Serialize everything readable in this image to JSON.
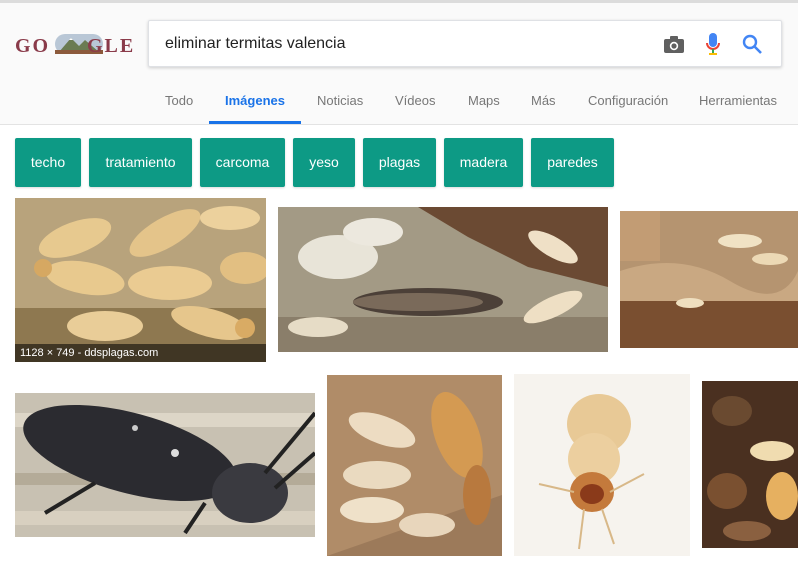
{
  "logo": {
    "text_left": "GO",
    "text_right": "GLE",
    "name": "google-logo"
  },
  "search": {
    "query": "eliminar termitas valencia",
    "placeholder": ""
  },
  "tabs": [
    {
      "label": "Todo"
    },
    {
      "label": "Imágenes",
      "active": true
    },
    {
      "label": "Noticias"
    },
    {
      "label": "Vídeos"
    },
    {
      "label": "Maps"
    },
    {
      "label": "Más"
    },
    {
      "label": "Configuración"
    },
    {
      "label": "Herramientas"
    }
  ],
  "chips": [
    "techo",
    "tratamiento",
    "carcoma",
    "yeso",
    "plagas",
    "madera",
    "paredes"
  ],
  "results": [
    {
      "subject": "termite-colony",
      "caption": "1128 × 749 - ddsplagas.com"
    },
    {
      "subject": "termites-larva-on-wood"
    },
    {
      "subject": "termites-in-wood-tunnels"
    },
    {
      "subject": "longhorn-beetle"
    },
    {
      "subject": "termite-soldier-and-workers"
    },
    {
      "subject": "single-termite-closeup"
    },
    {
      "subject": "termites-in-soil"
    }
  ],
  "colors": {
    "accent_blue": "#1a73e8",
    "chip_teal": "#0d9a85",
    "logo": "#8a3b4a"
  },
  "icons": {
    "camera": "camera-icon",
    "mic": "microphone-icon",
    "search": "search-icon"
  }
}
